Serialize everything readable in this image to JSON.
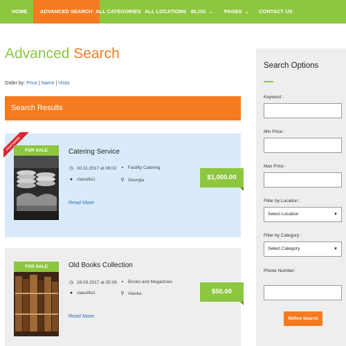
{
  "nav": {
    "home": "HOME",
    "advanced_search": "ADVANCED SEARCH",
    "all_categories": "ALL CATEGORIES",
    "all_locations": "ALL LOCATIONS",
    "blog": "BLOG",
    "pages": "PAGES",
    "contact_us": "CONTACT US"
  },
  "page_title": {
    "part1": "Advanced",
    "part2": "Search"
  },
  "order_by": {
    "prefix": "Order by: ",
    "price": "Price",
    "sep1": " | ",
    "name": "Name",
    "sep2": " | ",
    "visits": "Visits"
  },
  "results_header": "Search Results",
  "listings": [
    {
      "badge": "FOR SALE",
      "ribbon": "FEATURED",
      "title": "Catering Service",
      "date": "30.11.2017 at 06:02",
      "category": "Facility Catering",
      "author": "classifie1",
      "location": "Georgia",
      "read_more": "Read More",
      "price": "$1,000.00"
    },
    {
      "badge": "FOR SALE",
      "title": "Old Books Collection",
      "date": "28.09.2017 at 05:09",
      "category": "Books and Magazines",
      "author": "classifie1",
      "location": "Alaska",
      "read_more": "Read More",
      "price": "$50.00"
    }
  ],
  "sidebar": {
    "title": "Search Options",
    "keyword_label": "Keyword :",
    "min_price_label": "Min Price :",
    "max_price_label": "Max Price :",
    "location_label": "Filter by Location :",
    "location_value": "Select Location",
    "category_label": "Filter by Category :",
    "category_value": "Select Category",
    "phone_label": "Phone Number:",
    "refine_button": "Refine Search"
  },
  "colors": {
    "green": "#8dc63f",
    "orange": "#f47b20",
    "card_blue": "#d9ebfa",
    "card_gray": "#eeeeee",
    "link_blue": "#2a6fb5"
  },
  "icons": [
    "clock-icon",
    "folder-icon",
    "user-icon",
    "map-pin-icon",
    "chevron-down-icon"
  ]
}
